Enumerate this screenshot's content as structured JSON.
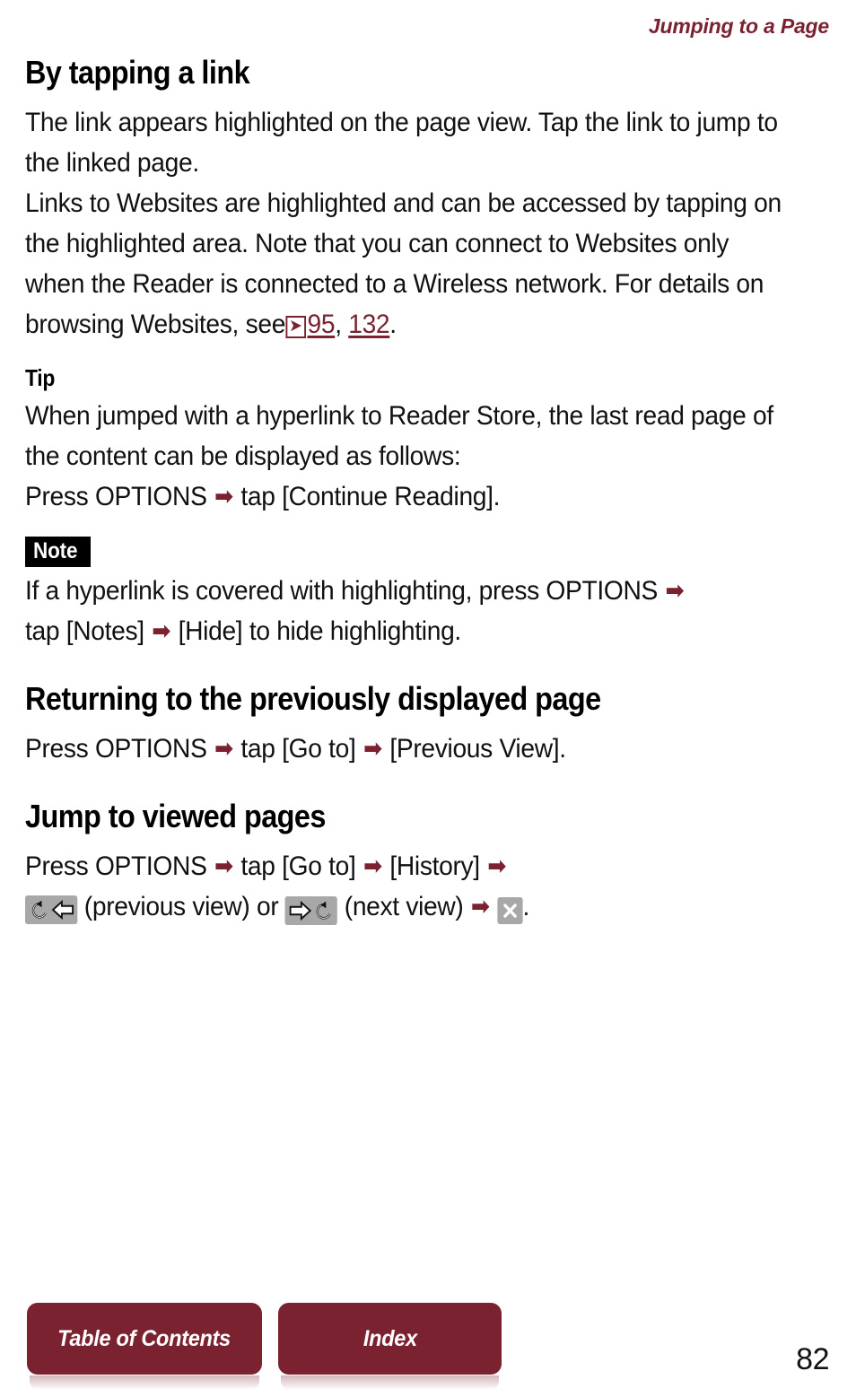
{
  "header": {
    "running_title": "Jumping to a Page",
    "accent_color": "#7a2230"
  },
  "sections": [
    {
      "heading": "By tapping a link",
      "paragraphs": [
        "The link appears highlighted on the page view. Tap the link to jump to the linked page.",
        "Links to Websites are highlighted and can be accessed by tapping on the highlighted area. Note that you can connect to Websites only when the Reader is connected to a Wireless network. For details on browsing Websites, see"
      ]
    }
  ],
  "reference": {
    "icon": "page-reference-icon",
    "icon_glyph": "➤",
    "pages": [
      "95",
      "132"
    ],
    "separator": ", ",
    "terminator": "."
  },
  "tip": {
    "label": "Tip",
    "lines": [
      "When jumped with a hyperlink to Reader Store, the last read page of the content can be displayed as follows:",
      "Press OPTIONS"
    ],
    "action_tail": "tap [Continue Reading]."
  },
  "note": {
    "label": "Note",
    "line1_before": "If a hyperlink is covered with highlighting, press OPTIONS",
    "line2_a": "tap [Notes]",
    "line2_b": "[Hide] to hide highlighting."
  },
  "returning": {
    "heading": "Returning to the previously displayed page",
    "step1": "Press OPTIONS",
    "step2": "tap [Go to]",
    "step3": "[Previous View]."
  },
  "jump": {
    "heading": "Jump to viewed pages",
    "step1": "Press OPTIONS",
    "step2": "tap [Go to]",
    "step3": "[History]",
    "prev_icon": "previous-view-key-icon",
    "prev_label": "(previous view)",
    "conjunction": "or",
    "next_icon": "next-view-key-icon",
    "next_label": "(next view)",
    "close_icon": "close-key-icon",
    "trailing": "."
  },
  "arrow_glyph": "➡",
  "footer": {
    "toc_label": "Table of Contents",
    "index_label": "Index",
    "page_number": "82"
  }
}
